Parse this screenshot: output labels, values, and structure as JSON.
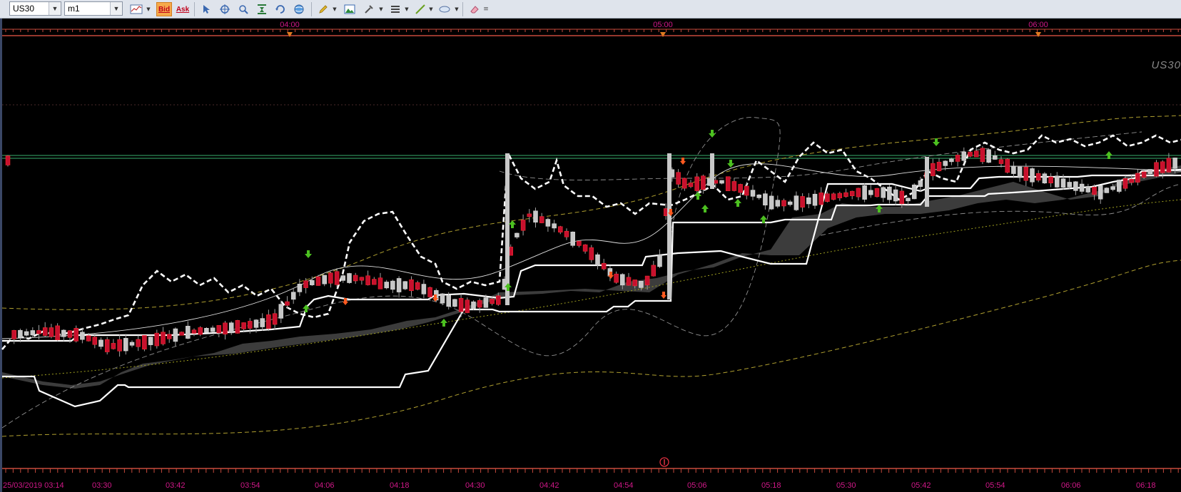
{
  "toolbar": {
    "symbol": "US30",
    "timeframe": "m1",
    "bid_label": "Bid",
    "ask_label": "Ask",
    "icons": [
      "chart-type-icon",
      "bid-icon",
      "ask-icon",
      "cursor-icon",
      "crosshair-icon",
      "magnifier-icon",
      "zoom-icon",
      "refresh-icon",
      "globe-icon",
      "pencil-icon",
      "image-icon",
      "tools-icon",
      "list-icon",
      "line-draw-icon",
      "ellipse-icon",
      "eraser-icon",
      "more-icon"
    ]
  },
  "chart": {
    "watermark": "US30",
    "top_times": [
      "04:00",
      "05:00",
      "06:00"
    ],
    "bottom_times": [
      "25/03/2019 03:14",
      "03:30",
      "03:42",
      "03:54",
      "04:06",
      "04:18",
      "04:30",
      "04:42",
      "04:54",
      "05:06",
      "05:18",
      "05:30",
      "05:42",
      "05:54",
      "06:06",
      "06:18"
    ],
    "colors": {
      "background": "#000000",
      "bull": "#c8c8c8",
      "bear": "#c8102e",
      "time_label": "#d01888",
      "bar_line": "#c84a3c",
      "cloud": "#3c3c3c",
      "level": "#2e8b57"
    }
  }
}
